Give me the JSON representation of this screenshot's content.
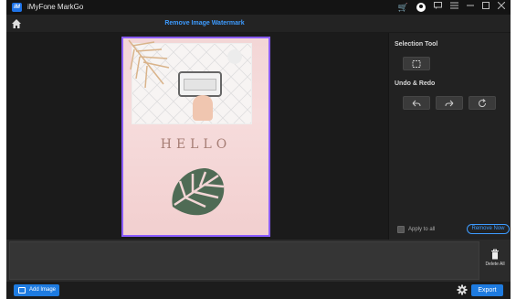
{
  "window": {
    "title": "iMyFone MarkGo",
    "logo_text": "iM"
  },
  "header": {
    "title": "Remove Image Watermark"
  },
  "canvas": {
    "image_text": "HELLO"
  },
  "panel": {
    "selection_tool_label": "Selection Tool",
    "undo_redo_label": "Undo & Redo",
    "apply_to_all_label": "Apply to all",
    "remove_now_label": "Remove Now"
  },
  "strip": {
    "delete_all_label": "Delete All"
  },
  "footer": {
    "add_image_label": "Add Image",
    "export_label": "Export"
  },
  "colors": {
    "accent": "#1e7be0",
    "title_accent": "#3d9bff",
    "selection_border": "#8a5cff",
    "cart": "#f0b400"
  },
  "icons": [
    "cart-icon",
    "user-icon",
    "message-icon",
    "menu-icon",
    "minimize-icon",
    "maximize-icon",
    "close-icon",
    "home-icon",
    "rectangle-select-icon",
    "undo-icon",
    "redo-icon",
    "reset-icon",
    "trash-icon",
    "add-image-icon",
    "gear-icon"
  ]
}
